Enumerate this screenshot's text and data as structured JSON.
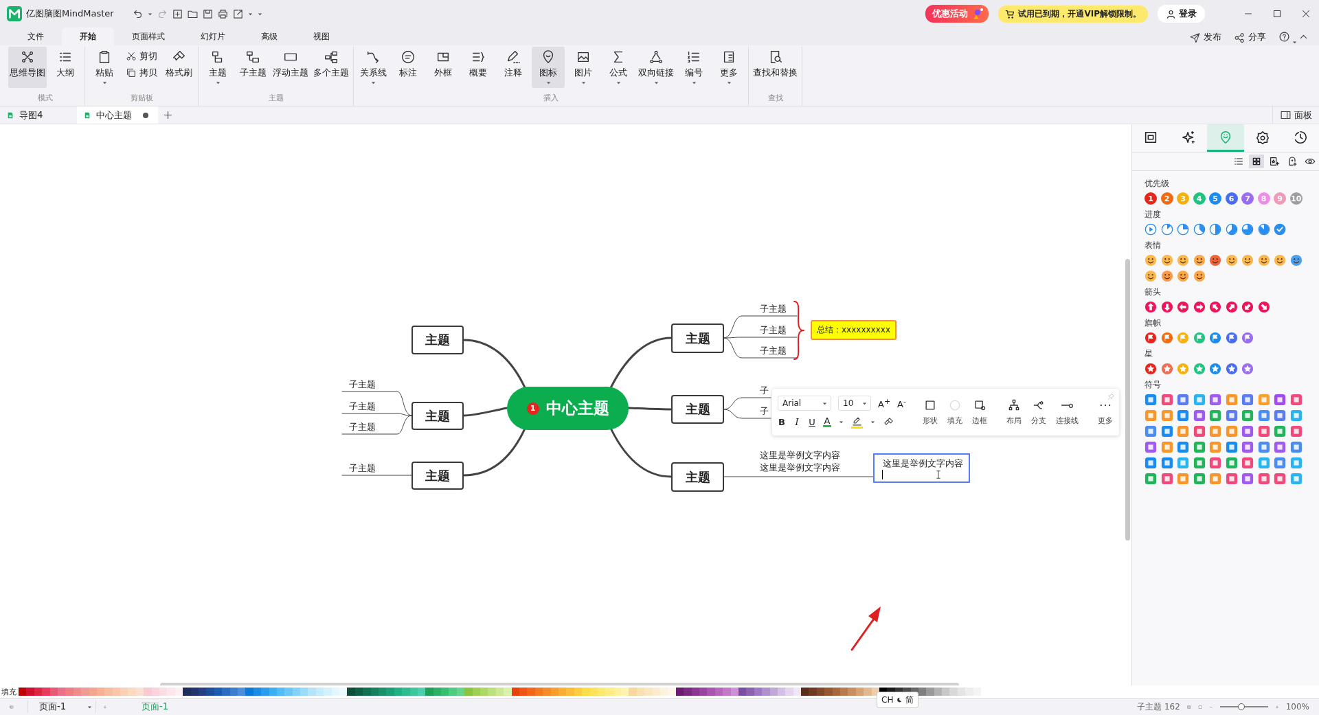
{
  "app": {
    "name": "亿图脑图MindMaster"
  },
  "promo": {
    "sale": "优惠活动",
    "trial": "试用已到期，开通VIP解锁限制。",
    "login": "登录"
  },
  "menu_tabs": [
    {
      "label": "文件",
      "selected": false
    },
    {
      "label": "开始",
      "selected": true
    },
    {
      "label": "页面样式",
      "selected": false
    },
    {
      "label": "幻灯片",
      "selected": false
    },
    {
      "label": "高级",
      "selected": false
    },
    {
      "label": "视图",
      "selected": false
    }
  ],
  "menu_actions": [
    "发布",
    "分享"
  ],
  "ribbon": [
    {
      "group": "模式",
      "buttons": [
        {
          "label": "思维导图",
          "kind": "big",
          "selected": true,
          "dropdown": false
        },
        {
          "label": "大纲",
          "kind": "big",
          "selected": false,
          "dropdown": false
        }
      ]
    },
    {
      "group": "剪贴板",
      "buttons": [
        {
          "label": "粘贴",
          "kind": "big",
          "selected": false,
          "dropdown": true
        },
        {
          "label": "剪切",
          "kind": "small",
          "selected": false,
          "dropdown": false
        },
        {
          "label": "拷贝",
          "kind": "small",
          "selected": false,
          "dropdown": false
        },
        {
          "label": "格式刷",
          "kind": "big",
          "selected": false,
          "dropdown": false
        }
      ]
    },
    {
      "group": "主题",
      "buttons": [
        {
          "label": "主题",
          "kind": "big",
          "selected": false,
          "dropdown": true
        },
        {
          "label": "子主题",
          "kind": "big",
          "selected": false,
          "dropdown": false
        },
        {
          "label": "浮动主题",
          "kind": "big",
          "selected": false,
          "dropdown": false
        },
        {
          "label": "多个主题",
          "kind": "big",
          "selected": false,
          "dropdown": false
        }
      ]
    },
    {
      "group": "插入",
      "buttons": [
        {
          "label": "关系线",
          "kind": "big",
          "selected": false,
          "dropdown": true
        },
        {
          "label": "标注",
          "kind": "big",
          "selected": false,
          "dropdown": false
        },
        {
          "label": "外框",
          "kind": "big",
          "selected": false,
          "dropdown": false
        },
        {
          "label": "概要",
          "kind": "big",
          "selected": false,
          "dropdown": false
        },
        {
          "label": "注释",
          "kind": "big",
          "selected": false,
          "dropdown": false
        },
        {
          "label": "图标",
          "kind": "big",
          "selected": true,
          "dropdown": true
        },
        {
          "label": "图片",
          "kind": "big",
          "selected": false,
          "dropdown": true
        },
        {
          "label": "公式",
          "kind": "big",
          "selected": false,
          "dropdown": true
        },
        {
          "label": "双向链接",
          "kind": "big",
          "selected": false,
          "dropdown": true
        },
        {
          "label": "编号",
          "kind": "big",
          "selected": false,
          "dropdown": true
        },
        {
          "label": "更多",
          "kind": "big",
          "selected": false,
          "dropdown": true
        }
      ]
    },
    {
      "group": "查找",
      "buttons": [
        {
          "label": "查找和替换",
          "kind": "big",
          "selected": false,
          "dropdown": false
        }
      ]
    }
  ],
  "doc_tabs": [
    {
      "label": "导图4",
      "selected": false,
      "unsaved": false
    },
    {
      "label": "中心主题",
      "selected": true,
      "unsaved": true
    }
  ],
  "panel_toggle": "面板",
  "mindmap": {
    "center": {
      "label": "中心主题",
      "priority": "1"
    },
    "topics": [
      {
        "label": "主题"
      },
      {
        "label": "主题",
        "subtopics": [
          "子主题",
          "子主题",
          "子主题"
        ]
      },
      {
        "label": "主题",
        "subtopics": [
          "子主题"
        ]
      },
      {
        "label": "主题",
        "subtopics": [
          "子主题",
          "子主题",
          "子主题"
        ],
        "summary": "总结：xxxxxxxxxx"
      },
      {
        "label": "主题",
        "subtopics": [
          "子",
          "子"
        ]
      },
      {
        "label": "主题",
        "note_lines": [
          "这里是举例文字内容",
          "这里是举例文字内容"
        ],
        "editing": "这里是举例文字内容"
      }
    ]
  },
  "text_toolbar": {
    "font": "Arial",
    "size": "10",
    "grow": "A$^{+}$",
    "shrink": "A$^{-}$",
    "bold": "B",
    "italic": "I",
    "underline": "U",
    "font_color": "A",
    "tools": [
      "形状",
      "填充",
      "边框",
      "布局",
      "分支",
      "连接线",
      "更多"
    ]
  },
  "panel": {
    "tabs": [
      {
        "selected": false
      },
      {
        "selected": false
      },
      {
        "selected": true
      },
      {
        "selected": false
      },
      {
        "selected": false
      }
    ],
    "views": [
      {
        "selected": false
      },
      {
        "selected": true
      },
      {
        "selected": false
      },
      {
        "selected": false
      },
      {
        "selected": false
      }
    ],
    "sections": [
      {
        "title": "优先级",
        "kind": "priority",
        "items": [
          {
            "label": "1",
            "color": "#e8251c"
          },
          {
            "label": "2",
            "color": "#f26b0f"
          },
          {
            "label": "3",
            "color": "#f8b10a"
          },
          {
            "label": "4",
            "color": "#1ec47f"
          },
          {
            "label": "5",
            "color": "#1a8cf0"
          },
          {
            "label": "6",
            "color": "#4a6cf0"
          },
          {
            "label": "7",
            "color": "#9a6cf0"
          },
          {
            "label": "8",
            "color": "#f08ce8"
          },
          {
            "label": "9",
            "color": "#f09ab8"
          },
          {
            "label": "10",
            "color": "#9e9e9e"
          }
        ]
      },
      {
        "title": "进度",
        "kind": "progress",
        "items": [
          {
            "kind": "start"
          },
          {
            "kind": "pie"
          },
          {
            "kind": "pie"
          },
          {
            "kind": "pie"
          },
          {
            "kind": "pie"
          },
          {
            "kind": "pie"
          },
          {
            "kind": "pie"
          },
          {
            "kind": "pie"
          },
          {
            "kind": "done"
          }
        ]
      },
      {
        "title": "表情",
        "kind": "emotion",
        "items": [
          {
            "color": "#f9b84a"
          },
          {
            "color": "#f9b84a"
          },
          {
            "color": "#f9b84a"
          },
          {
            "color": "#f9a84a"
          },
          {
            "color": "#f0643a"
          },
          {
            "color": "#f9b84a"
          },
          {
            "color": "#f9b84a"
          },
          {
            "color": "#f9b84a"
          },
          {
            "color": "#f9b84a"
          },
          {
            "color": "#4aa0f0"
          },
          {
            "color": "#f9b84a"
          },
          {
            "color": "#f99a4a"
          },
          {
            "color": "#f9a84a"
          },
          {
            "color": "#f9a84a"
          }
        ]
      },
      {
        "title": "箭头",
        "kind": "arrow",
        "items": [
          {
            "kind": "up"
          },
          {
            "kind": "down"
          },
          {
            "kind": "left"
          },
          {
            "kind": "right"
          },
          {
            "kind": "up-left"
          },
          {
            "kind": "up-right"
          },
          {
            "kind": "down-left"
          },
          {
            "kind": "down-right"
          }
        ]
      },
      {
        "title": "旗帜",
        "kind": "flag",
        "items": [
          {
            "color": "#e8251c"
          },
          {
            "color": "#f26b0f"
          },
          {
            "color": "#f8b10a"
          },
          {
            "color": "#1ec47f"
          },
          {
            "color": "#1a8cf0"
          },
          {
            "color": "#4a6cf0"
          },
          {
            "color": "#9a6cf0"
          }
        ]
      },
      {
        "title": "星",
        "kind": "star",
        "items": [
          {
            "color": "#e8251c"
          },
          {
            "color": "#f26b4f"
          },
          {
            "color": "#f8b10a"
          },
          {
            "color": "#1ec47f"
          },
          {
            "color": "#1a8cf0"
          },
          {
            "color": "#4a6cf0"
          },
          {
            "color": "#9a6cf0"
          }
        ]
      },
      {
        "title": "符号",
        "kind": "symbol",
        "items": [
          {
            "color": "#1a8cf0"
          },
          {
            "color": "#f04a7a"
          },
          {
            "color": "#5a7cf0"
          },
          {
            "color": "#2ab4f0"
          },
          {
            "color": "#a05af0"
          },
          {
            "color": "#f8962a"
          },
          {
            "color": "#5a7cf0"
          },
          {
            "color": "#f8a02a"
          },
          {
            "color": "#a04af0"
          },
          {
            "color": "#f04a7a"
          },
          {
            "color": "#f8962a"
          },
          {
            "color": "#f8962a"
          },
          {
            "color": "#1a8cf0"
          },
          {
            "color": "#a05af0"
          },
          {
            "color": "#22b45a"
          },
          {
            "color": "#5a7cf0"
          },
          {
            "color": "#22b45a"
          },
          {
            "color": "#4a8cf0"
          },
          {
            "color": "#5a7cf0"
          },
          {
            "color": "#2ab4f0"
          },
          {
            "color": "#4a8cf0"
          },
          {
            "color": "#1a8cf0"
          },
          {
            "color": "#f8962a"
          },
          {
            "color": "#f04a7a"
          },
          {
            "color": "#f8962b"
          },
          {
            "color": "#f8962c"
          },
          {
            "color": "#a05af0"
          },
          {
            "color": "#f04a7a"
          },
          {
            "color": "#22b45a"
          },
          {
            "color": "#f04a7b"
          },
          {
            "color": "#a05af0"
          },
          {
            "color": "#f8962a"
          },
          {
            "color": "#1a8cf0"
          },
          {
            "color": "#22b45a"
          },
          {
            "color": "#f8962a"
          },
          {
            "color": "#1a8cf0"
          },
          {
            "color": "#a05af0"
          },
          {
            "color": "#4a8cf0"
          },
          {
            "color": "#a05af0"
          },
          {
            "color": "#4a8cf0"
          },
          {
            "color": "#1a8cf0"
          },
          {
            "color": "#1a8cf0"
          },
          {
            "color": "#2ab4f0"
          },
          {
            "color": "#22b45a"
          },
          {
            "color": "#f04a7a"
          },
          {
            "color": "#22b45a"
          },
          {
            "color": "#f04a7a"
          },
          {
            "color": "#2ab4f0"
          },
          {
            "color": "#4a8cf0"
          },
          {
            "color": "#2ab4f0"
          },
          {
            "color": "#22b45a"
          },
          {
            "color": "#f04a7a"
          },
          {
            "color": "#f8962a"
          },
          {
            "color": "#22b45a"
          },
          {
            "color": "#f8962a"
          },
          {
            "color": "#f04a7a"
          },
          {
            "color": "#a05af0"
          },
          {
            "color": "#f04a7a"
          },
          {
            "color": "#f04a7a"
          },
          {
            "color": "#2ab4f0"
          }
        ]
      }
    ]
  },
  "palette": {
    "label": "填充",
    "swatches": [
      {
        "color": "#c00000"
      },
      {
        "color": "#d0112b"
      },
      {
        "color": "#dc2543"
      },
      {
        "color": "#e43c5a"
      },
      {
        "color": "#e85a74"
      },
      {
        "color": "#ec6f8a"
      },
      {
        "color": "#ee7d84"
      },
      {
        "color": "#f08c8c"
      },
      {
        "color": "#f29b96"
      },
      {
        "color": "#f4a58e"
      },
      {
        "color": "#f6b094"
      },
      {
        "color": "#f8bc9e"
      },
      {
        "color": "#f9c6a9"
      },
      {
        "color": "#fad1b6"
      },
      {
        "color": "#fbd9c3"
      },
      {
        "color": "#fbe0cf"
      },
      {
        "color": "#f9c9d4"
      },
      {
        "color": "#fad3dc"
      },
      {
        "color": "#fbdde4"
      },
      {
        "color": "#fce7ec"
      },
      {
        "color": "#fdf0f3"
      },
      {
        "color": "#1f2d5a"
      },
      {
        "color": "#22356e"
      },
      {
        "color": "#253f82"
      },
      {
        "color": "#1e4e9a"
      },
      {
        "color": "#1a5db0"
      },
      {
        "color": "#2b6cc0"
      },
      {
        "color": "#3c7dce"
      },
      {
        "color": "#4a8fdc"
      },
      {
        "color": "#0a7bd8"
      },
      {
        "color": "#1a8ce4"
      },
      {
        "color": "#2a9cee"
      },
      {
        "color": "#3caef4"
      },
      {
        "color": "#50bdf6"
      },
      {
        "color": "#6ac8f8"
      },
      {
        "color": "#84d2fa"
      },
      {
        "color": "#9cdcfb"
      },
      {
        "color": "#b4e4fc"
      },
      {
        "color": "#c6ebfd"
      },
      {
        "color": "#d6f1fe"
      },
      {
        "color": "#e4f6fe"
      },
      {
        "color": "#eef9ff"
      },
      {
        "color": "#0d4d3a"
      },
      {
        "color": "#0f5e46"
      },
      {
        "color": "#127052"
      },
      {
        "color": "#15805e"
      },
      {
        "color": "#18906a"
      },
      {
        "color": "#1aa076"
      },
      {
        "color": "#1fb083"
      },
      {
        "color": "#2cbc90"
      },
      {
        "color": "#3cc69c"
      },
      {
        "color": "#4ccfa8"
      },
      {
        "color": "#22a05a"
      },
      {
        "color": "#2cb064"
      },
      {
        "color": "#36bf6e"
      },
      {
        "color": "#4ccc7c"
      },
      {
        "color": "#66d48e"
      },
      {
        "color": "#8bc53f"
      },
      {
        "color": "#9ccf52"
      },
      {
        "color": "#acd866"
      },
      {
        "color": "#bce07c"
      },
      {
        "color": "#cce894"
      },
      {
        "color": "#dcf0ae"
      },
      {
        "color": "#e8420c"
      },
      {
        "color": "#ee5514"
      },
      {
        "color": "#f2661c"
      },
      {
        "color": "#f47a22"
      },
      {
        "color": "#f68c28"
      },
      {
        "color": "#f89e2e"
      },
      {
        "color": "#faae34"
      },
      {
        "color": "#fcbe3a"
      },
      {
        "color": "#fece40"
      },
      {
        "color": "#ffdc4a"
      },
      {
        "color": "#ffe45a"
      },
      {
        "color": "#ffe86e"
      },
      {
        "color": "#ffec84"
      },
      {
        "color": "#fff09a"
      },
      {
        "color": "#fff3b0"
      },
      {
        "color": "#f8d8a0"
      },
      {
        "color": "#f9e0b0"
      },
      {
        "color": "#fae6c0"
      },
      {
        "color": "#fbecd0"
      },
      {
        "color": "#fcf2de"
      },
      {
        "color": "#fdf7ea"
      },
      {
        "color": "#6a1f6e"
      },
      {
        "color": "#7a2a80"
      },
      {
        "color": "#8a3692"
      },
      {
        "color": "#9a44a2"
      },
      {
        "color": "#a854b0"
      },
      {
        "color": "#b666bc"
      },
      {
        "color": "#c27ac8"
      },
      {
        "color": "#ce90d4"
      },
      {
        "color": "#7a4ea0"
      },
      {
        "color": "#8c62b0"
      },
      {
        "color": "#9e78c0"
      },
      {
        "color": "#b090cc"
      },
      {
        "color": "#c2a8d8"
      },
      {
        "color": "#d4c0e4"
      },
      {
        "color": "#e4d6ee"
      },
      {
        "color": "#f0e8f6"
      },
      {
        "color": "#5a2e1a"
      },
      {
        "color": "#6e3a22"
      },
      {
        "color": "#82482a"
      },
      {
        "color": "#965834"
      },
      {
        "color": "#a8683e"
      },
      {
        "color": "#ba7a4c"
      },
      {
        "color": "#c88e60"
      },
      {
        "color": "#d6a278"
      },
      {
        "color": "#e2b892"
      },
      {
        "color": "#eccdac"
      },
      {
        "color": "#000000"
      },
      {
        "color": "#1a1a1a"
      },
      {
        "color": "#333333"
      },
      {
        "color": "#4d4d4d"
      },
      {
        "color": "#666666"
      },
      {
        "color": "#7f7f7f"
      },
      {
        "color": "#999999"
      },
      {
        "color": "#b2b2b2"
      },
      {
        "color": "#c8c8c8"
      },
      {
        "color": "#d8d8d8"
      },
      {
        "color": "#e4e4e4"
      },
      {
        "color": "#eeeeee"
      },
      {
        "color": "#f4f4f4"
      }
    ]
  },
  "ime": {
    "lang": "CH",
    "mode": "简"
  },
  "status": {
    "page_select": "页面-1",
    "page_tab": "页面-1",
    "count": "子主题 162",
    "zoom": "100%"
  },
  "zoom_slider": {
    "level": 0.45
  }
}
